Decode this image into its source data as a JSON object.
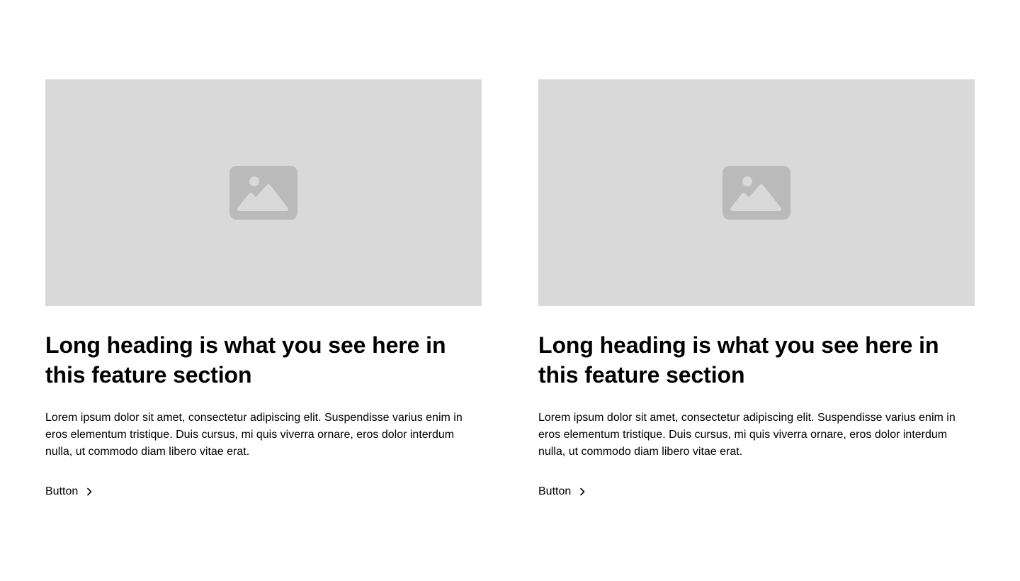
{
  "cards": [
    {
      "image_icon": "image-placeholder-icon",
      "heading": "Long heading is what you see here in this feature section",
      "body": "Lorem ipsum dolor sit amet, consectetur adipiscing elit. Suspendisse varius enim in eros elementum tristique. Duis cursus, mi quis viverra ornare, eros dolor interdum nulla, ut commodo diam libero vitae erat.",
      "button_label": "Button",
      "button_icon": "chevron-right-icon"
    },
    {
      "image_icon": "image-placeholder-icon",
      "heading": "Long heading is what you see here in this feature section",
      "body": "Lorem ipsum dolor sit amet, consectetur adipiscing elit. Suspendisse varius enim in eros elementum tristique. Duis cursus, mi quis viverra ornare, eros dolor interdum nulla, ut commodo diam libero vitae erat.",
      "button_label": "Button",
      "button_icon": "chevron-right-icon"
    }
  ],
  "colors": {
    "image_background": "#d9d9d9",
    "image_icon": "#bababa",
    "text": "#000000",
    "page_background": "#ffffff"
  }
}
